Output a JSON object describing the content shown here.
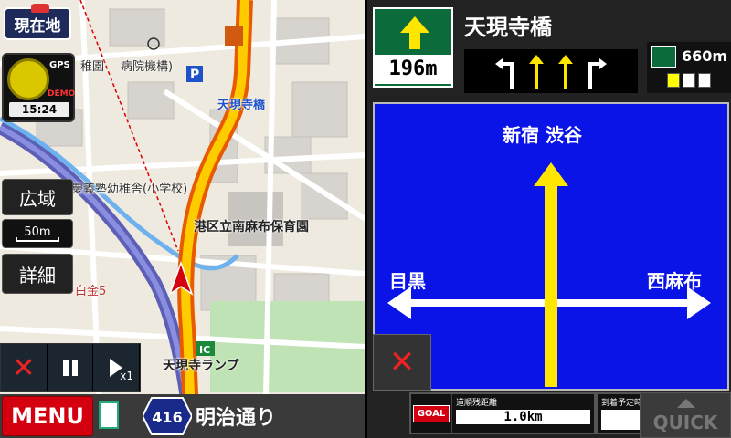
{
  "map": {
    "current_location_label": "現在地",
    "compass": {
      "gps": "GPS",
      "demo": "DEMO",
      "time": "15:24"
    },
    "wide_label": "広域",
    "scale_label": "50m",
    "detail_label": "詳細",
    "labels": {
      "kindergarten": "稚園",
      "hospital": "病院機構)",
      "tengenji_bridge": "天現寺橋",
      "school": "慶義塾幼稚舎(小学校)",
      "nursery": "港区立南麻布保育園",
      "area": "白金5",
      "ramp": "天現寺ランプ"
    },
    "playback": {
      "speed": "x1"
    },
    "menu_label": "MENU",
    "road_number": "416",
    "road_name": "明治通り"
  },
  "guidance": {
    "distance": "196m",
    "intersection_name": "天現寺橋",
    "next_distance": "660m",
    "junction": {
      "ahead": "新宿 渋谷",
      "left": "目黒",
      "right": "西麻布"
    },
    "trip": {
      "goal_label": "GOAL",
      "remaining_label": "道順残距離",
      "remaining_value": "1.0km",
      "eta_label": "到着予定時間"
    },
    "quick_label": "QUICK"
  },
  "colors": {
    "route": "#ffcc00",
    "route_casing": "#e85a00",
    "junction_bg": "#0a14e6",
    "sign_green": "#0b6b3a",
    "menu_red": "#d40010"
  }
}
